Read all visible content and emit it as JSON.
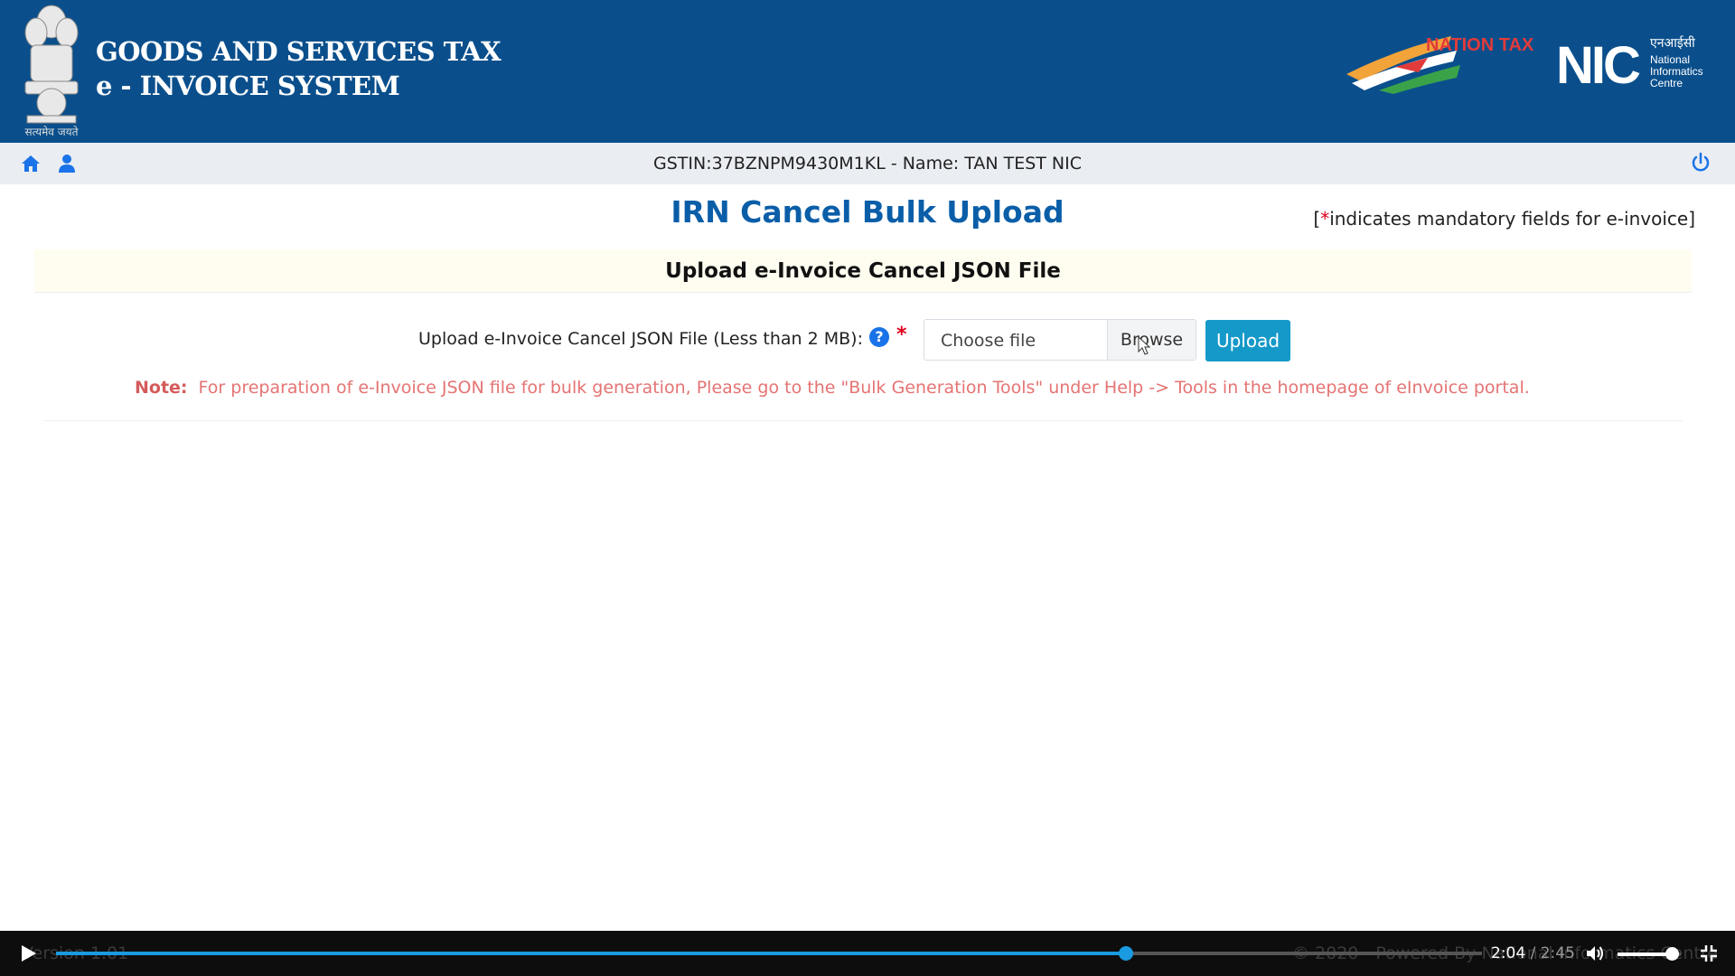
{
  "header": {
    "title_line1": "GOODS AND SERVICES TAX",
    "title_line2": "e - INVOICE SYSTEM",
    "emblem_motto": "सत्यमेव जयते",
    "ntm_logo": "NATION TAX MARKET",
    "nic_logo": {
      "abbr": "NIC",
      "hindi": "एनआईसी",
      "full": "National Informatics Centre"
    }
  },
  "navbar": {
    "icons": [
      "home-icon",
      "user-icon"
    ],
    "gstin_text": "GSTIN:37BZNPM9430M1KL - Name: TAN TEST NIC",
    "right_icon": "power-icon"
  },
  "main": {
    "title": "IRN Cancel Bulk Upload",
    "mandatory_star": "*",
    "mandatory_text": "indicates mandatory fields for e-invoice",
    "section_title": "Upload e-Invoice Cancel JSON File",
    "upload_label": "Upload e-Invoice Cancel JSON File (Less than 2 MB):",
    "help_glyph": "?",
    "required_star": "*",
    "file_placeholder": "Choose file",
    "browse_label": "Browse",
    "upload_button": "Upload",
    "note_label": "Note:",
    "note_text": "For preparation of e-Invoice JSON file for bulk generation, Please go to the \"Bulk Generation Tools\" under Help -> Tools in the homepage of eInvoice portal."
  },
  "player": {
    "current_time": "2:04",
    "separator": " / ",
    "total_time": "2:45",
    "progress": 0.75,
    "volume": 0.85,
    "footer_left": "Version 1.01",
    "footer_right": "© 2020 - Powered By National Informatics Centre"
  },
  "colors": {
    "header_bg": "#0a4f8c",
    "title_blue": "#0a5ea8",
    "upload_btn": "#1599c9",
    "note": "#e57373",
    "required": "#e0001b"
  }
}
